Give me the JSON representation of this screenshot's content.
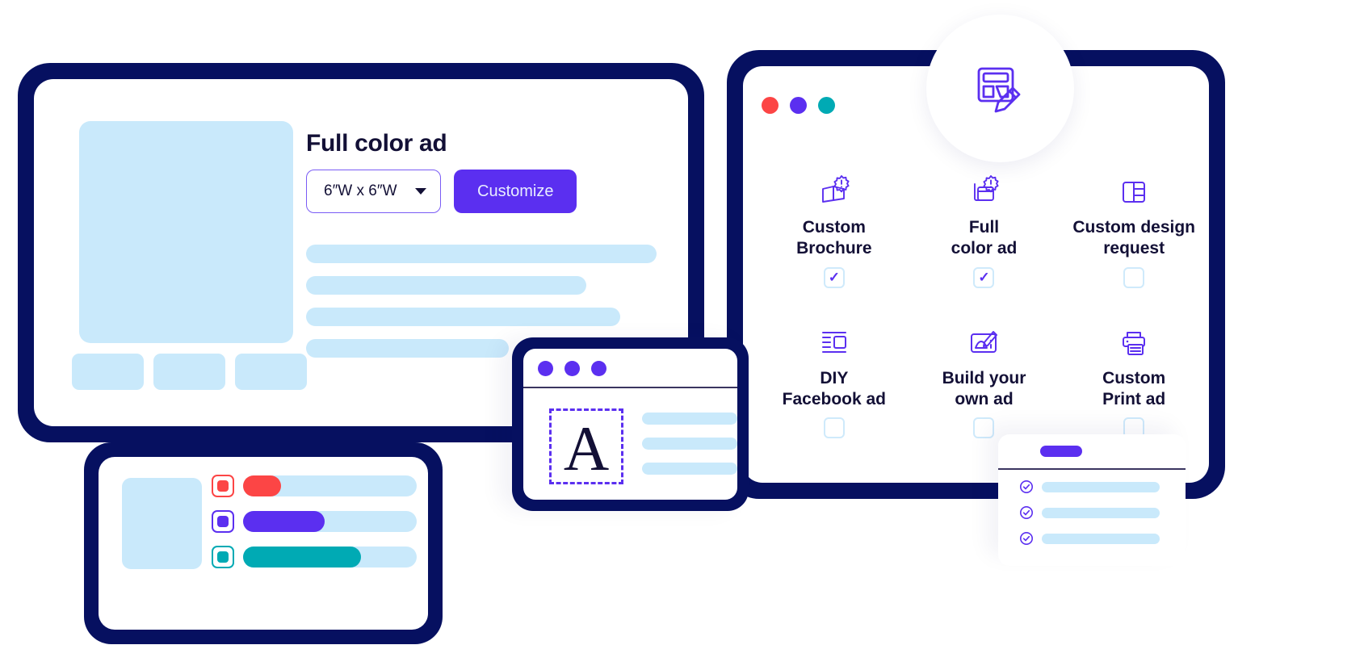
{
  "left_panel": {
    "title": "Full color ad",
    "size_select": {
      "value": "6″W x 6″W",
      "icon": "chevron-down-icon"
    },
    "cta_label": "Customize",
    "thumbnail": "ad-preview-placeholder",
    "skeleton_line_widths": [
      434,
      347,
      389,
      251
    ],
    "chip_count": 3
  },
  "right_panel": {
    "window_dots": [
      {
        "name": "close-dot",
        "color": "#fc4545"
      },
      {
        "name": "minimize-dot",
        "color": "#5b2ff0"
      },
      {
        "name": "maximize-dot",
        "color": "#00aab4"
      }
    ],
    "badge_icon": "design-edit-icon",
    "options": [
      {
        "label": "Custom\nBrochure",
        "icon": "brochure-spark-icon",
        "checked": true
      },
      {
        "label": "Full\ncolor ad",
        "icon": "color-ad-spark-icon",
        "checked": true
      },
      {
        "label": "Custom design\nrequest",
        "icon": "layout-grid-icon",
        "checked": false
      },
      {
        "label": "DIY\nFacebook ad",
        "icon": "facebook-ad-layout-icon",
        "checked": false
      },
      {
        "label": "Build your\nown ad",
        "icon": "build-ad-pencil-icon",
        "checked": false
      },
      {
        "label": "Custom\nPrint ad",
        "icon": "printer-icon",
        "checked": false
      }
    ],
    "checkmark_glyph": "✓"
  },
  "swatch_card": {
    "thumbnail": "swatch-preview-placeholder",
    "rows": [
      {
        "color": "#fc4545",
        "fill_percent": 22
      },
      {
        "color": "#5b2ff0",
        "fill_percent": 47
      },
      {
        "color": "#00aab4",
        "fill_percent": 68
      }
    ]
  },
  "text_card": {
    "window_dots": [
      {
        "name": "dot-one",
        "color": "#5b2ff0"
      },
      {
        "name": "dot-two",
        "color": "#5b2ff0"
      },
      {
        "name": "dot-three",
        "color": "#5b2ff0"
      }
    ],
    "selected_letter": "A",
    "skeleton_lines": 3
  },
  "checklist_card": {
    "pill": "action-pill",
    "items": [
      {
        "icon": "check-circle-icon",
        "checked": true
      },
      {
        "icon": "check-circle-icon",
        "checked": true
      },
      {
        "icon": "check-circle-icon",
        "checked": true
      }
    ]
  },
  "colors": {
    "frame_navy": "#061060",
    "accent_purple": "#5b2ff0",
    "skeleton_blue": "#c9e9fb",
    "text_dark": "#131036",
    "red": "#fc4545",
    "teal": "#00aab4",
    "checkbox_border": "#cfeafb"
  }
}
